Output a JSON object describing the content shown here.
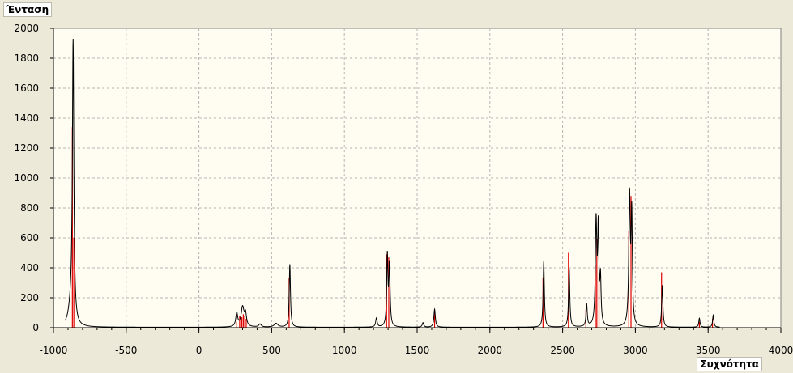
{
  "chart_data": {
    "type": "line",
    "xlabel": "Συχνότητα",
    "ylabel": "Ένταση",
    "xlim": [
      -1000,
      4000
    ],
    "ylim": [
      0,
      2000
    ],
    "x_ticks": [
      -1000,
      -500,
      0,
      500,
      1000,
      1500,
      2000,
      2500,
      3000,
      3500,
      4000
    ],
    "y_ticks": [
      0,
      200,
      400,
      600,
      800,
      1000,
      1200,
      1400,
      1600,
      1800,
      2000
    ],
    "grid": true,
    "colors": {
      "spectrum": "#000000",
      "sticks": "#e00000",
      "plot_bg": "#fffdf2",
      "grid": "#b4b4b4"
    },
    "series": [
      {
        "kind": "broadened-spectrum",
        "peaks": [
          {
            "x": -865,
            "y": 1850,
            "w": 6
          },
          {
            "x": -880,
            "y": 120,
            "w": 20
          },
          {
            "x": 260,
            "y": 90,
            "w": 8
          },
          {
            "x": 300,
            "y": 130,
            "w": 12
          },
          {
            "x": 320,
            "y": 80,
            "w": 8
          },
          {
            "x": 420,
            "y": 20,
            "w": 10
          },
          {
            "x": 530,
            "y": 25,
            "w": 15
          },
          {
            "x": 625,
            "y": 420,
            "w": 5
          },
          {
            "x": 1220,
            "y": 60,
            "w": 6
          },
          {
            "x": 1295,
            "y": 470,
            "w": 5
          },
          {
            "x": 1310,
            "y": 400,
            "w": 5
          },
          {
            "x": 1540,
            "y": 30,
            "w": 6
          },
          {
            "x": 1620,
            "y": 120,
            "w": 6
          },
          {
            "x": 2370,
            "y": 440,
            "w": 5
          },
          {
            "x": 2545,
            "y": 390,
            "w": 5
          },
          {
            "x": 2665,
            "y": 150,
            "w": 5
          },
          {
            "x": 2730,
            "y": 690,
            "w": 6
          },
          {
            "x": 2745,
            "y": 620,
            "w": 5
          },
          {
            "x": 2760,
            "y": 300,
            "w": 5
          },
          {
            "x": 2960,
            "y": 860,
            "w": 6
          },
          {
            "x": 2975,
            "y": 720,
            "w": 5
          },
          {
            "x": 3185,
            "y": 280,
            "w": 5
          },
          {
            "x": 3440,
            "y": 60,
            "w": 5
          },
          {
            "x": 3535,
            "y": 80,
            "w": 5
          }
        ]
      },
      {
        "kind": "sticks",
        "x": [
          -870,
          -860,
          260,
          280,
          295,
          305,
          315,
          325,
          620,
          1290,
          1305,
          1620,
          2365,
          2540,
          2660,
          2725,
          2735,
          2750,
          2955,
          2970,
          3180,
          3440,
          3530
        ],
        "y": [
          1340,
          600,
          40,
          80,
          70,
          90,
          80,
          60,
          330,
          490,
          470,
          110,
          330,
          500,
          120,
          420,
          590,
          340,
          650,
          880,
          370,
          40,
          60
        ]
      }
    ]
  }
}
